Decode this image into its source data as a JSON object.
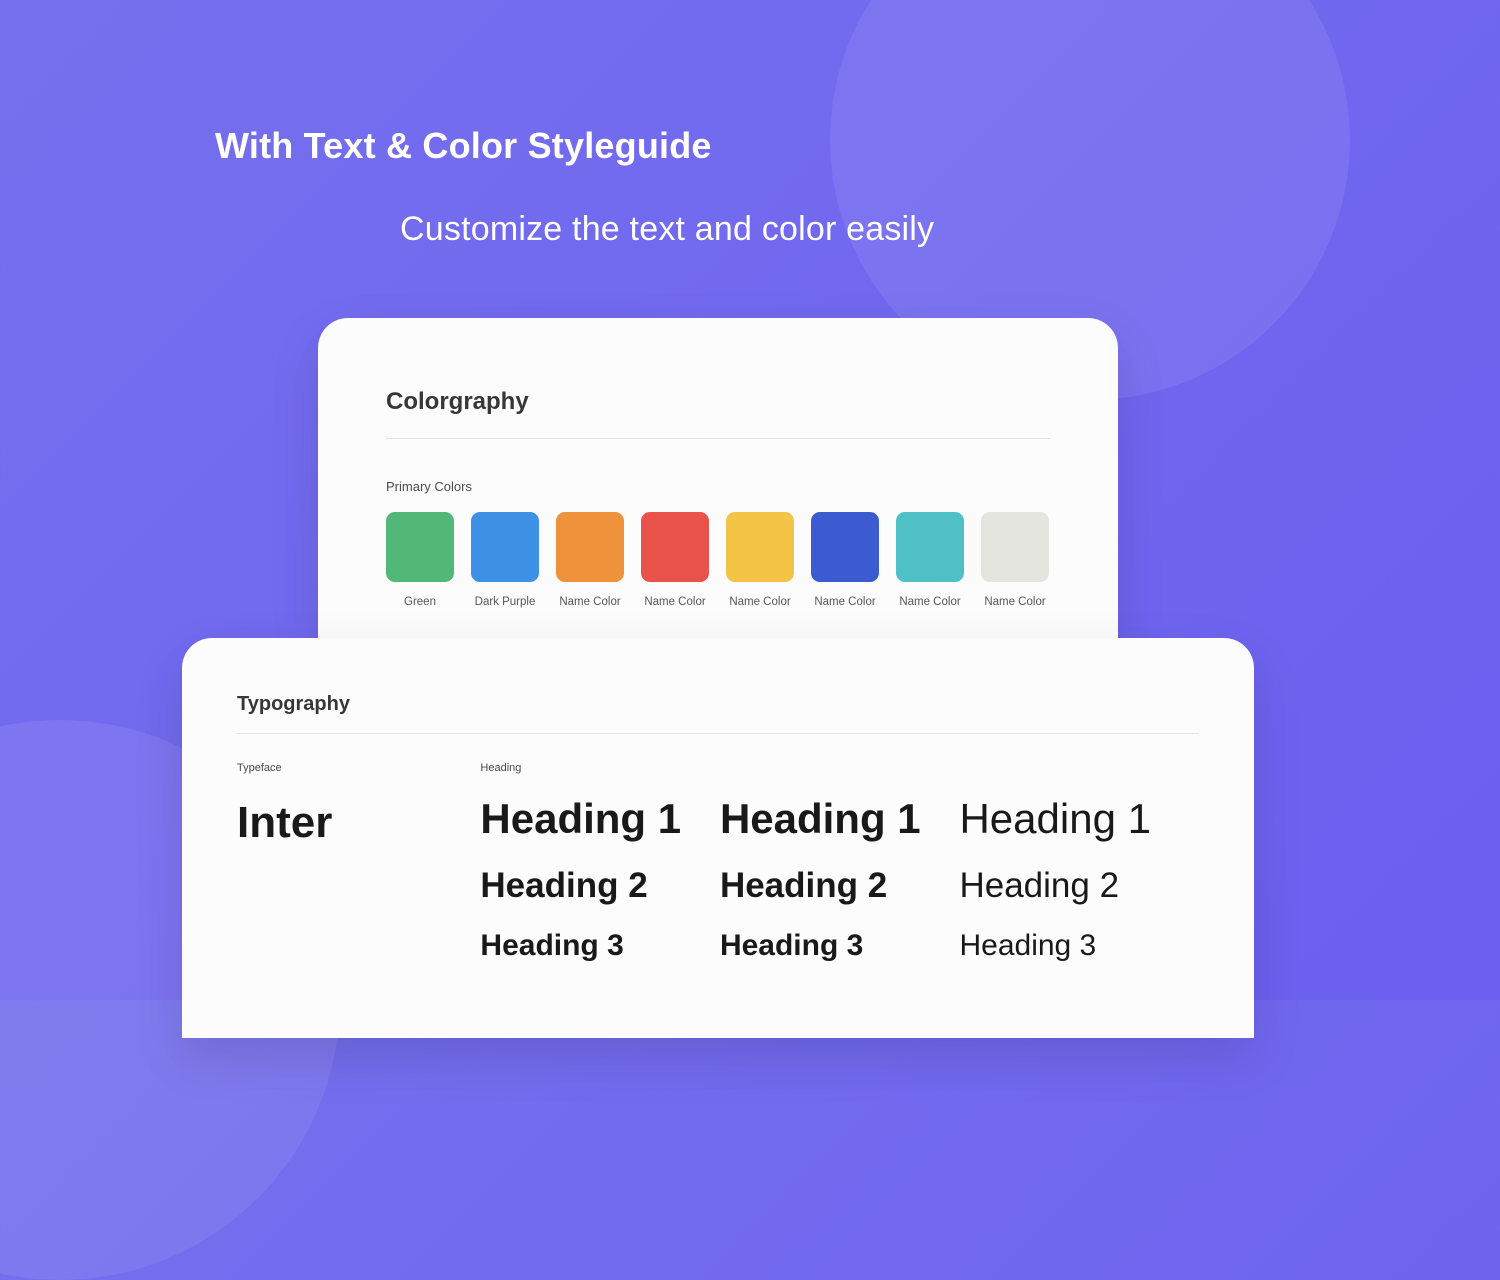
{
  "header": {
    "title": "With Text & Color Styleguide",
    "subtitle": "Customize the text and color easily"
  },
  "colorgraphy": {
    "title": "Colorgraphy",
    "subLabel": "Primary Colors",
    "swatches": [
      {
        "name": "Green",
        "hex": "#52b877"
      },
      {
        "name": "Dark Purple",
        "hex": "#3f90e7"
      },
      {
        "name": "Name Color",
        "hex": "#ee923b"
      },
      {
        "name": "Name Color",
        "hex": "#e8524b"
      },
      {
        "name": "Name Color",
        "hex": "#f4c447"
      },
      {
        "name": "Name Color",
        "hex": "#3d5bd0"
      },
      {
        "name": "Name Color",
        "hex": "#4ec0c6"
      },
      {
        "name": "Name Color",
        "hex": "#e5e5e0"
      }
    ]
  },
  "typography": {
    "title": "Typography",
    "typeface": {
      "label": "Typeface",
      "name": "Inter"
    },
    "headingLabel": "Heading",
    "headings": {
      "h1": "Heading 1",
      "h2": "Heading 2",
      "h3": "Heading 3"
    }
  }
}
